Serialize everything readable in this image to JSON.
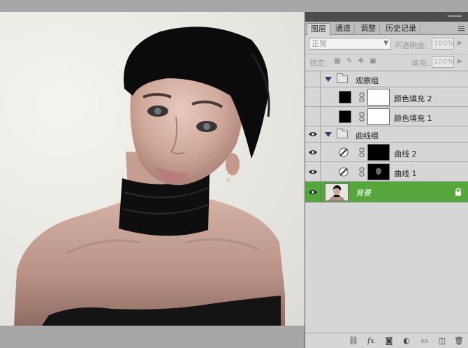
{
  "tabs": [
    {
      "label": "图层",
      "active": true
    },
    {
      "label": "通道",
      "active": false
    },
    {
      "label": "调整",
      "active": false
    },
    {
      "label": "历史记录",
      "active": false
    }
  ],
  "blend": {
    "mode": "正常",
    "opacity_label": "不透明度:",
    "opacity_value": "100%"
  },
  "lock": {
    "label": "锁定:",
    "fill_label": "填充:",
    "fill_value": "100%"
  },
  "layers": [
    {
      "name": "观察组",
      "kind": "group",
      "visible": false,
      "expanded": true
    },
    {
      "name": "颜色填充 2",
      "kind": "fill",
      "visible": false
    },
    {
      "name": "颜色填充 1",
      "kind": "fill",
      "visible": false
    },
    {
      "name": "曲线组",
      "kind": "group",
      "visible": true,
      "expanded": true
    },
    {
      "name": "曲线 2",
      "kind": "curves",
      "visible": true
    },
    {
      "name": "曲线 1",
      "kind": "curves",
      "visible": true
    },
    {
      "name": "背景",
      "kind": "background",
      "visible": true,
      "selected": true,
      "locked": true
    }
  ],
  "colors": {
    "selection": "#55a63b",
    "panel_bg": "#d6d6d6",
    "canvas_bg": "#a7a7a7"
  },
  "footer_icons": [
    "link-icon",
    "fx-icon",
    "mask-icon",
    "adjustment-icon",
    "folder-icon",
    "new-layer-icon",
    "trash-icon"
  ]
}
